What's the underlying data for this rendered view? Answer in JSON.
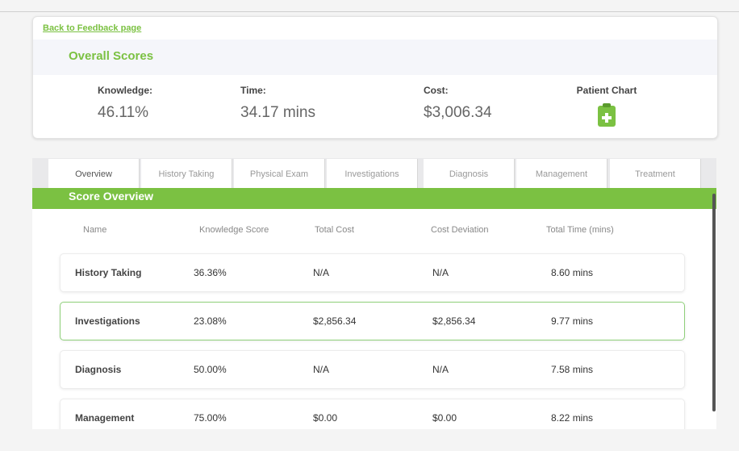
{
  "back_link": "Back to Feedback page",
  "overall": {
    "title": "Overall Scores",
    "knowledge": {
      "label": "Knowledge:",
      "value": "46.11%"
    },
    "time": {
      "label": "Time:",
      "value": "34.17 mins"
    },
    "cost": {
      "label": "Cost:",
      "value": "$3,006.34"
    },
    "patient_chart": {
      "label": "Patient Chart",
      "icon": "clipboard-plus-icon"
    }
  },
  "tabs": [
    {
      "label": "Overview",
      "active": true
    },
    {
      "label": "History Taking"
    },
    {
      "label": "Physical Exam"
    },
    {
      "label": "Investigations"
    },
    {
      "label": "Diagnosis"
    },
    {
      "label": "Management"
    },
    {
      "label": "Treatment"
    }
  ],
  "score_overview": {
    "title": "Score Overview",
    "columns": [
      "Name",
      "Knowledge Score",
      "Total Cost",
      "Cost Deviation",
      "Total Time (mins)"
    ],
    "rows": [
      {
        "name": "History Taking",
        "knowledge": "36.36%",
        "total_cost": "N/A",
        "cost_deviation": "N/A",
        "total_time": "8.60 mins"
      },
      {
        "name": "Investigations",
        "knowledge": "23.08%",
        "total_cost": "$2,856.34",
        "cost_deviation": "$2,856.34",
        "total_time": "9.77 mins"
      },
      {
        "name": "Diagnosis",
        "knowledge": "50.00%",
        "total_cost": "N/A",
        "cost_deviation": "N/A",
        "total_time": "7.58 mins"
      },
      {
        "name": "Management",
        "knowledge": "75.00%",
        "total_cost": "$0.00",
        "cost_deviation": "$0.00",
        "total_time": "8.22 mins"
      }
    ]
  },
  "colors": {
    "accent": "#7bc142"
  }
}
